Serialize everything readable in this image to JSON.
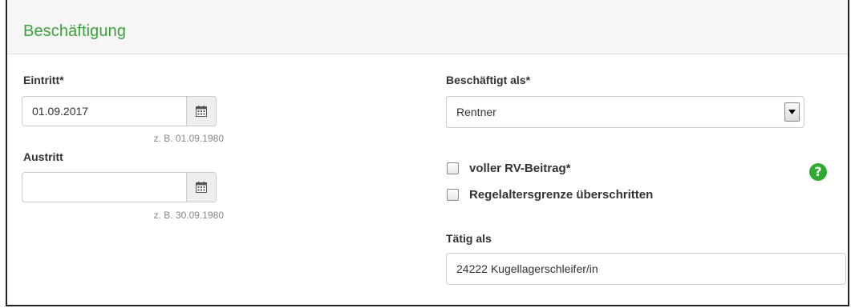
{
  "panel": {
    "title": "Beschäftigung"
  },
  "eintritt": {
    "label": "Eintritt*",
    "value": "01.09.2017",
    "hint": "z. B. 01.09.1980",
    "icon": "calendar-icon"
  },
  "austritt": {
    "label": "Austritt",
    "value": "",
    "hint": "z. B. 30.09.1980",
    "icon": "calendar-icon"
  },
  "beschaeftigt_als": {
    "label": "Beschäftigt als*",
    "selected": "Rentner",
    "icon": "dropdown-arrow-icon"
  },
  "checkboxes": [
    {
      "label": "voller RV-Beitrag*",
      "checked": false
    },
    {
      "label": "Regelaltersgrenze überschritten",
      "checked": false
    }
  ],
  "help": {
    "glyph": "?",
    "icon": "help-icon",
    "color": "#2eaa2e"
  },
  "taetig_als": {
    "label": "Tätig als",
    "value": "24222 Kugellagerschleifer/in"
  },
  "colors": {
    "title": "#3aa33a",
    "header_bg": "#f6f6f6"
  }
}
